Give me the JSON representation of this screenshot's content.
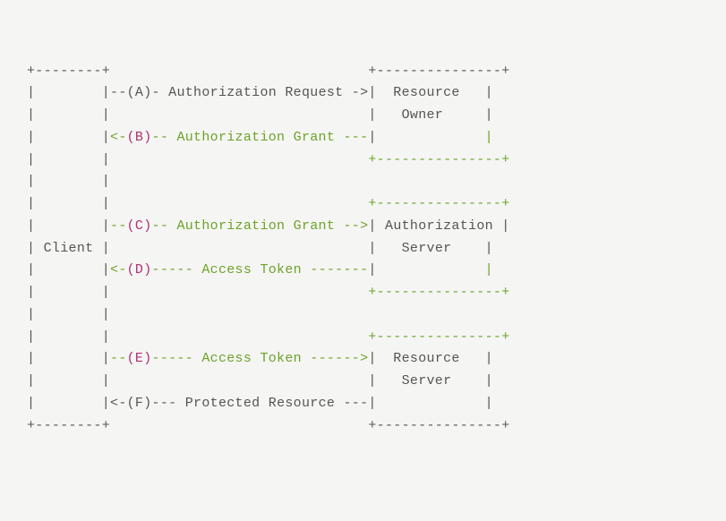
{
  "client": "Client",
  "resource_owner_l1": "  Resource   ",
  "resource_owner_l2": "   Owner     ",
  "auth_server_l1": "Authorization",
  "auth_server_l2": "   Server    ",
  "resource_server_l1": "  Resource   ",
  "resource_server_l2": "   Server    ",
  "step_a_label": "(A)",
  "step_a_msg": "Authorization Request",
  "step_b_label": "(B)",
  "step_b_msg": "Authorization Grant",
  "step_c_label": "(C)",
  "step_c_msg": "Authorization Grant",
  "step_d_label": "(D)",
  "step_d_msg": "Access Token",
  "step_e_label": "(E)",
  "step_e_msg": "Access Token",
  "step_f_label": "(F)",
  "step_f_msg": "Protected Resource"
}
